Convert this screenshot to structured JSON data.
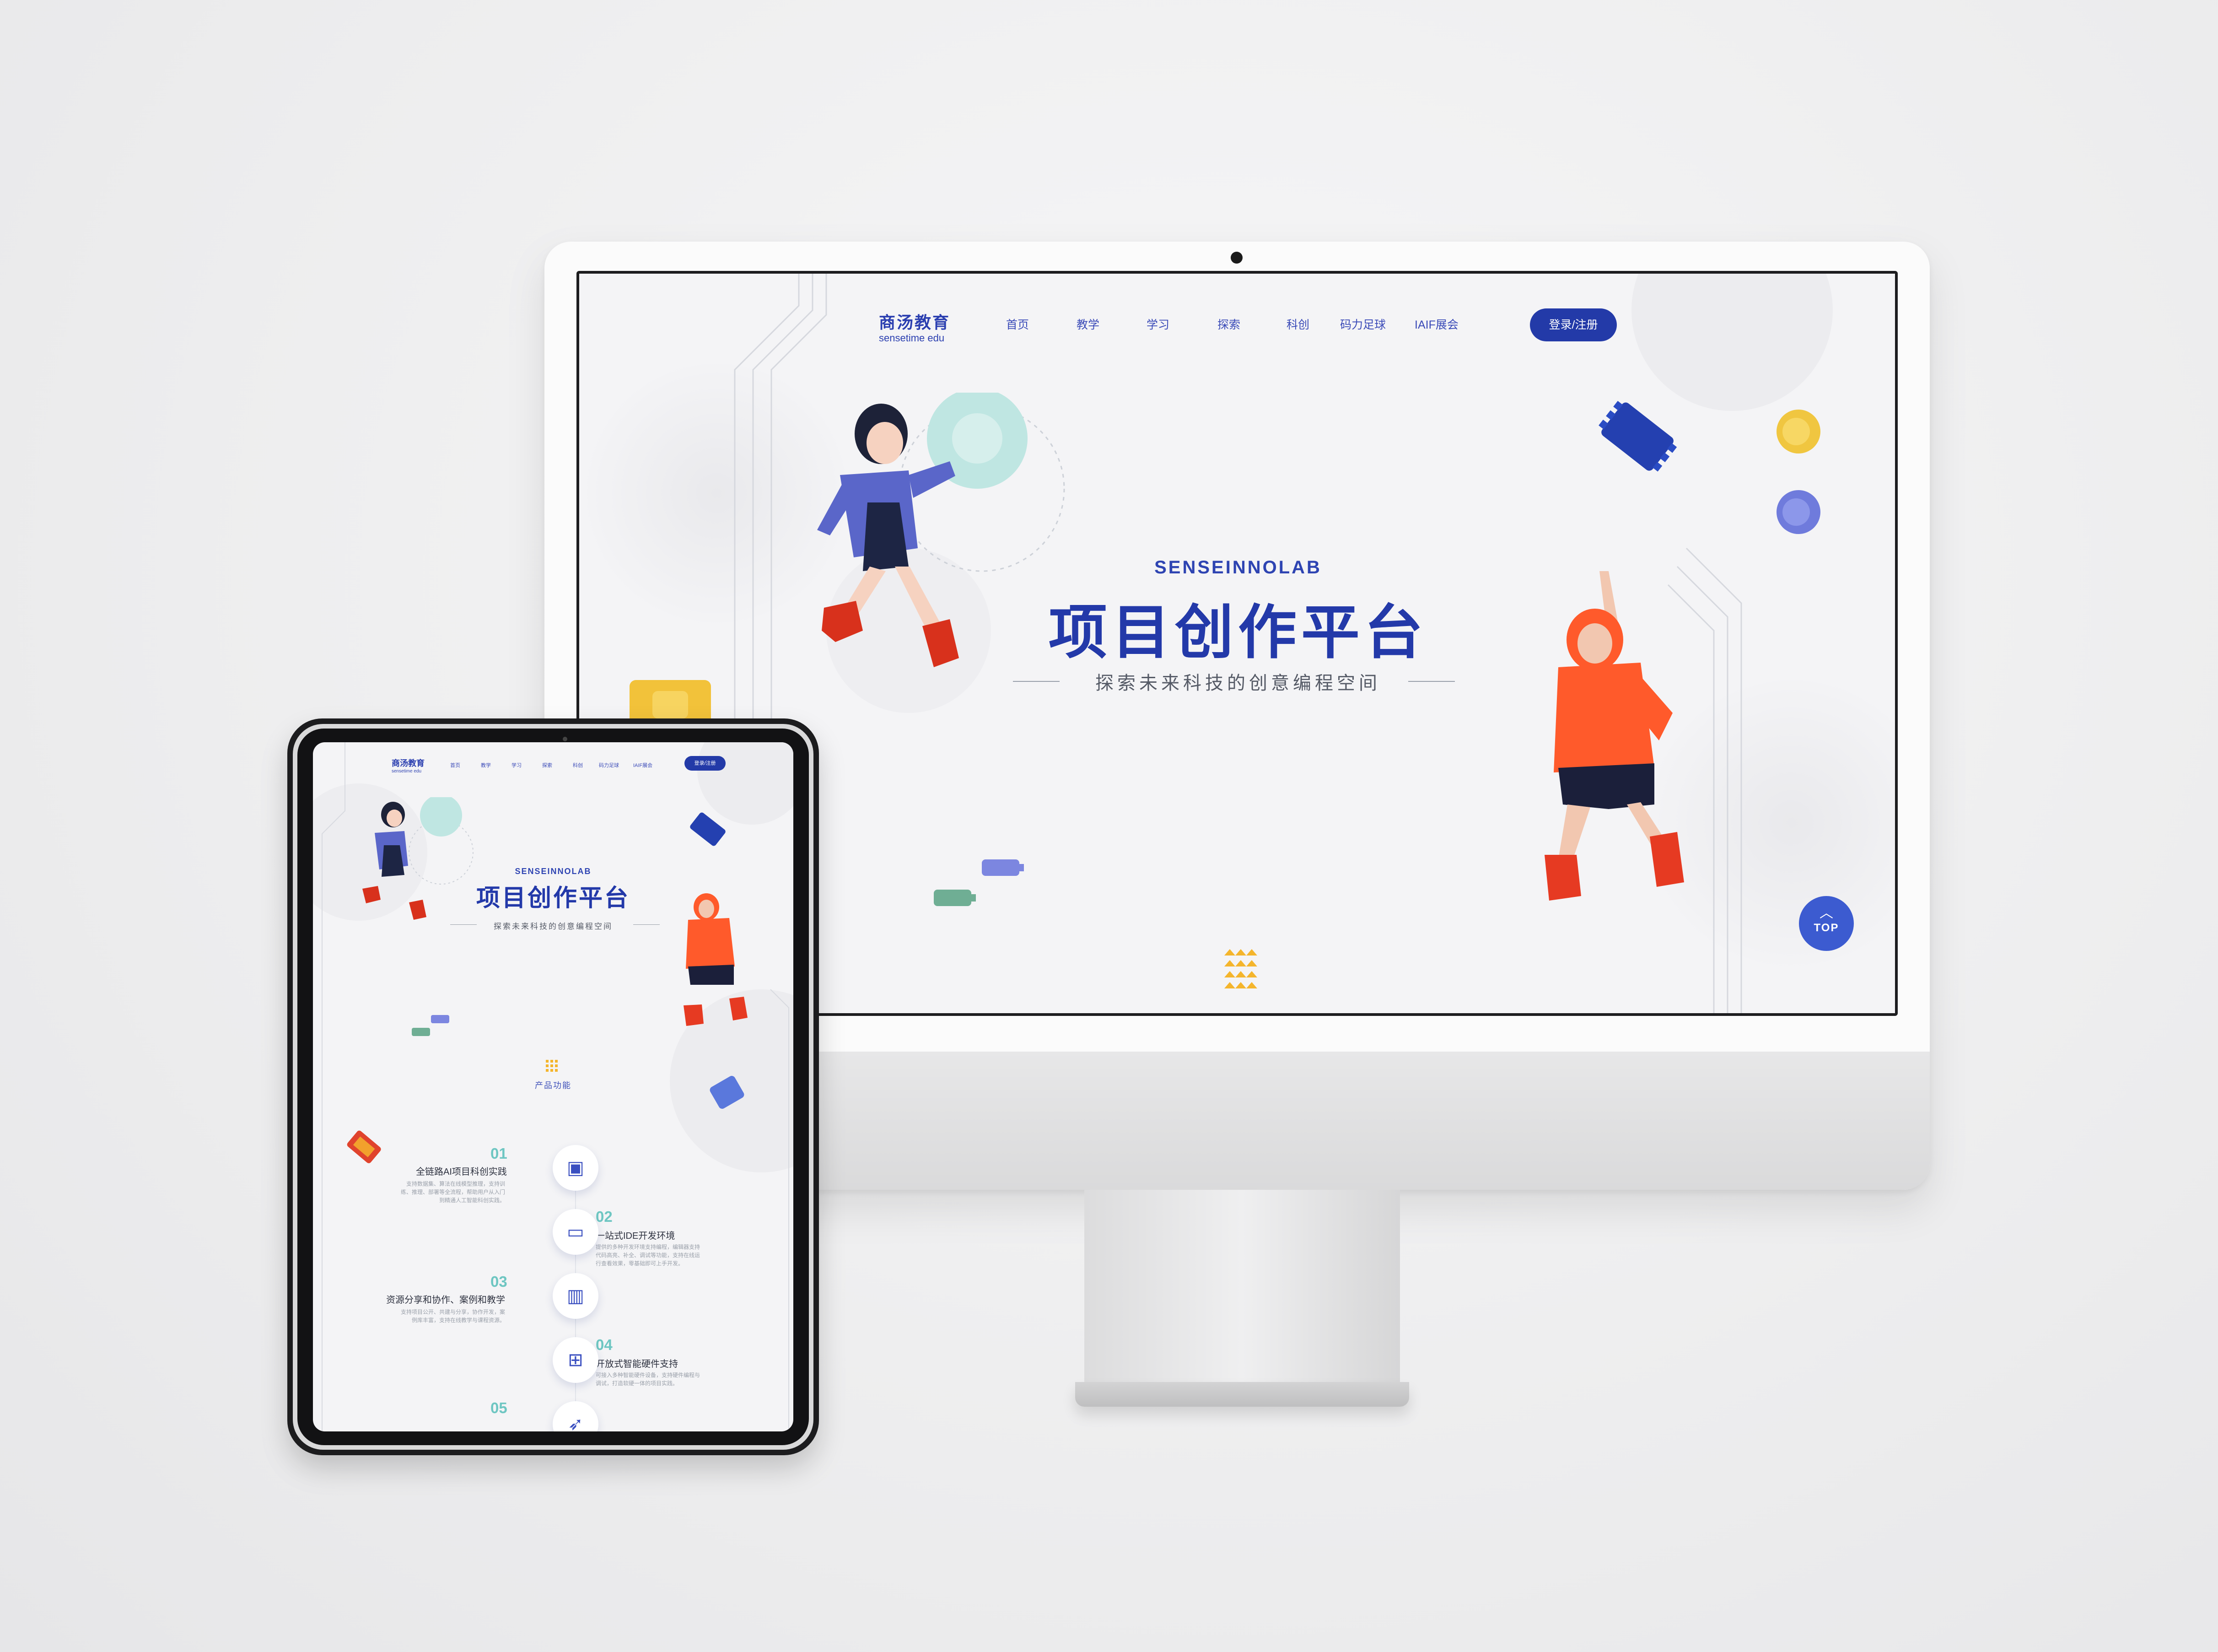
{
  "desktop": {
    "logo": {
      "cn": "商汤教育",
      "en": "sensetime edu"
    },
    "nav": [
      "首页",
      "教学",
      "学习",
      "探索",
      "科创",
      "码力足球",
      "IAIF展会"
    ],
    "login": "登录/注册",
    "hero": {
      "kicker": "SENSEINNOLAB",
      "title": "项目创作平台",
      "tagline": "探索未来科技的创意编程空间"
    },
    "top_button": {
      "icon": "chevron-up-icon",
      "label": "TOP"
    }
  },
  "tablet": {
    "logo": {
      "cn": "商汤教育",
      "en": "sensetime edu"
    },
    "nav": [
      "首页",
      "教学",
      "学习",
      "探索",
      "科创",
      "码力足球",
      "IAIF展会"
    ],
    "login": "登录/注册",
    "hero": {
      "kicker": "SENSEINNOLAB",
      "title": "项目创作平台",
      "tagline": "探索未来科技的创意编程空间"
    },
    "section_title": "产品功能",
    "features": [
      {
        "num": "01",
        "title": "全链路AI项目科创实践",
        "desc": "支持数据集、算法在线模型推理，支持训练、推理、部署等全流程，帮助用户从入门到精通人工智能科创实践。",
        "icon": "chip-icon"
      },
      {
        "num": "02",
        "title": "一站式IDE开发环境",
        "desc": "提供的多种开发环境支持编程，编辑器支持代码高亮、补全、调试等功能，支持在线运行查看效果，零基础即可上手开发。",
        "icon": "laptop-icon"
      },
      {
        "num": "03",
        "title": "资源分享和协作、案例和教学",
        "desc": "支持项目公开、共建与分享，协作开发，案例库丰富，支持在线教学与课程资源。",
        "icon": "book-icon"
      },
      {
        "num": "04",
        "title": "开放式智能硬件支持",
        "desc": "可接入多种智能硬件设备，支持硬件编程与调试，打造软硬一体的项目实践。",
        "icon": "calculator-icon"
      },
      {
        "num": "05",
        "title": "",
        "desc": "",
        "icon": "rocket-icon"
      }
    ]
  },
  "colors": {
    "brand": "#2339a9",
    "accent_teal": "#6ec6c2",
    "orange": "#f0572d",
    "yellow": "#f4c430"
  }
}
